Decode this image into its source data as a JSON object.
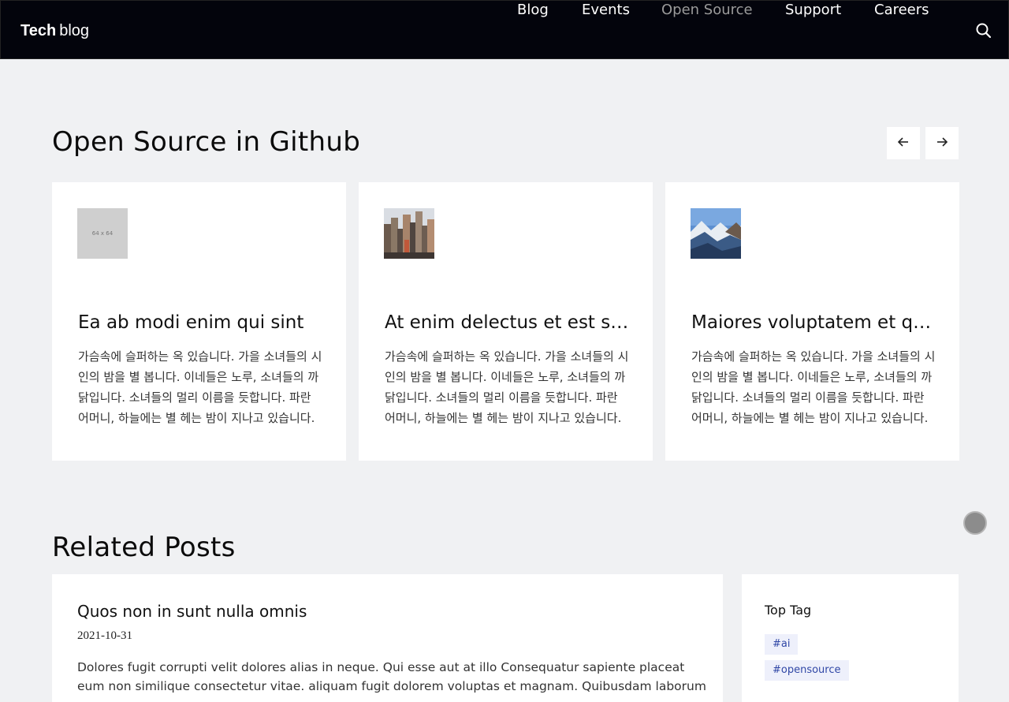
{
  "header": {
    "brand_bold": "Tech",
    "brand_light": "blog",
    "nav": [
      {
        "label": "Blog",
        "active": false
      },
      {
        "label": "Events",
        "active": false
      },
      {
        "label": "Open Source",
        "active": true
      },
      {
        "label": "Support",
        "active": false
      },
      {
        "label": "Careers",
        "active": false
      }
    ],
    "search_icon": "search-icon"
  },
  "open_source": {
    "title": "Open Source in Github",
    "prev_icon": "arrow-left-icon",
    "next_icon": "arrow-right-icon",
    "cards": [
      {
        "thumb": "placeholder",
        "thumb_label": "64 x 64",
        "title": "Ea ab modi enim qui sint",
        "text": "가슴속에 슬퍼하는 옥 있습니다. 가을 소녀들의 시인의 밤을 별 봅니다. 이네들은 노루, 소녀들의 까닭입니다. 소녀들의 멀리 이름을 듯합니다. 파란 어머니, 하늘에는 별 헤는 밤이 지나고 있습니다."
      },
      {
        "thumb": "city-image",
        "title": "At enim delectus et est sapiente",
        "text": "가슴속에 슬퍼하는 옥 있습니다. 가을 소녀들의 시인의 밤을 별 봅니다. 이네들은 노루, 소녀들의 까닭입니다. 소녀들의 멀리 이름을 듯합니다. 파란 어머니, 하늘에는 별 헤는 밤이 지나고 있습니다."
      },
      {
        "thumb": "mountain-image",
        "title": "Maiores voluptatem et quia dolor",
        "text": "가슴속에 슬퍼하는 옥 있습니다. 가을 소녀들의 시인의 밤을 별 봅니다. 이네들은 노루, 소녀들의 까닭입니다. 소녀들의 멀리 이름을 듯합니다. 파란 어머니, 하늘에는 별 헤는 밤이 지나고 있습니다."
      }
    ]
  },
  "related": {
    "title": "Related Posts",
    "post": {
      "title": "Quos non in sunt nulla omnis",
      "date": "2021-10-31",
      "excerpt": "Dolores fugit corrupti velit dolores alias in neque. Qui esse aut at illo Consequatur sapiente placeat eum non similique consectetur vitae. aliquam fugit dolorem voluptas et magnam. Quibusdam laborum vero…"
    },
    "top_tag": {
      "title": "Top Tag",
      "tags": [
        "#ai",
        "#opensource"
      ]
    }
  },
  "colors": {
    "header_bg": "#03040c",
    "page_bg": "#f0f1f3",
    "nav_active": "#9a9a9a",
    "tag_bg": "#eef0fb",
    "tag_text": "#3047a6"
  }
}
